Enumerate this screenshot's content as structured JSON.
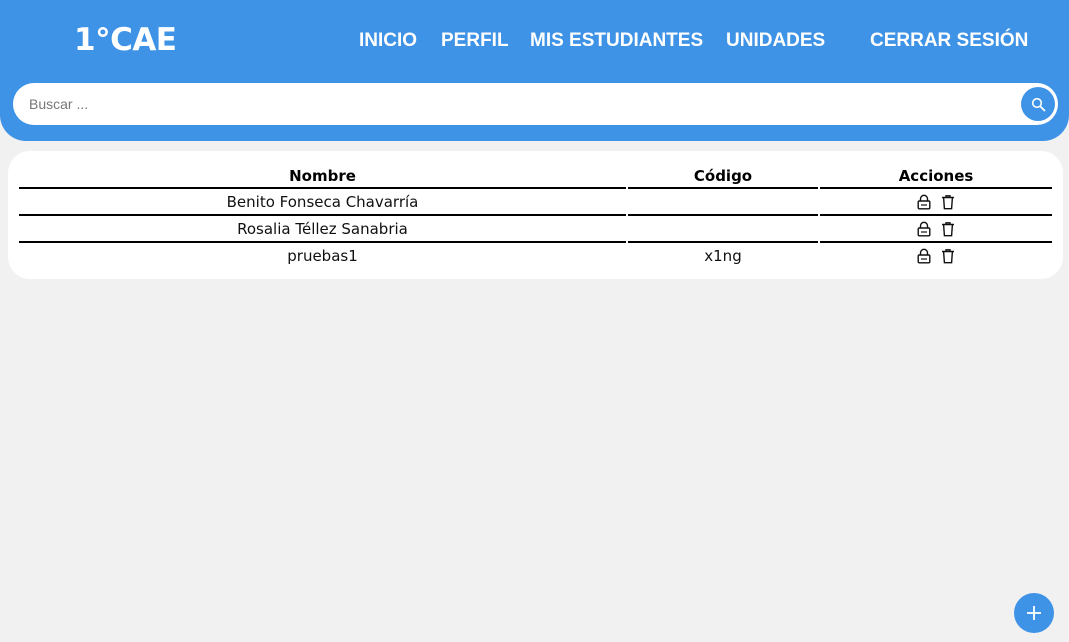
{
  "header": {
    "logo": "1°CAE",
    "nav": {
      "inicio": "INICIO",
      "perfil": "PERFIL",
      "mis_estudiantes": "MIS ESTUDIANTES",
      "unidades": "UNIDADES",
      "cerrar_sesion": "CERRAR SESIÓN"
    },
    "search": {
      "placeholder": "Buscar ...",
      "value": "",
      "icon": "search-icon"
    }
  },
  "table": {
    "columns": [
      "Nombre",
      "Código",
      "Acciones"
    ],
    "rows": [
      {
        "nombre": "Benito Fonseca Chavarría",
        "codigo": "",
        "acciones": [
          "lock-icon",
          "trash-icon"
        ]
      },
      {
        "nombre": "Rosalia Téllez Sanabria",
        "codigo": "",
        "acciones": [
          "lock-icon",
          "trash-icon"
        ]
      },
      {
        "nombre": "pruebas1",
        "codigo": "x1ng",
        "acciones": [
          "lock-icon",
          "trash-icon"
        ]
      }
    ]
  },
  "fab": {
    "icon": "plus-icon"
  },
  "colors": {
    "primary": "#3f93e6",
    "background": "#f1f1f1",
    "card": "#ffffff"
  }
}
